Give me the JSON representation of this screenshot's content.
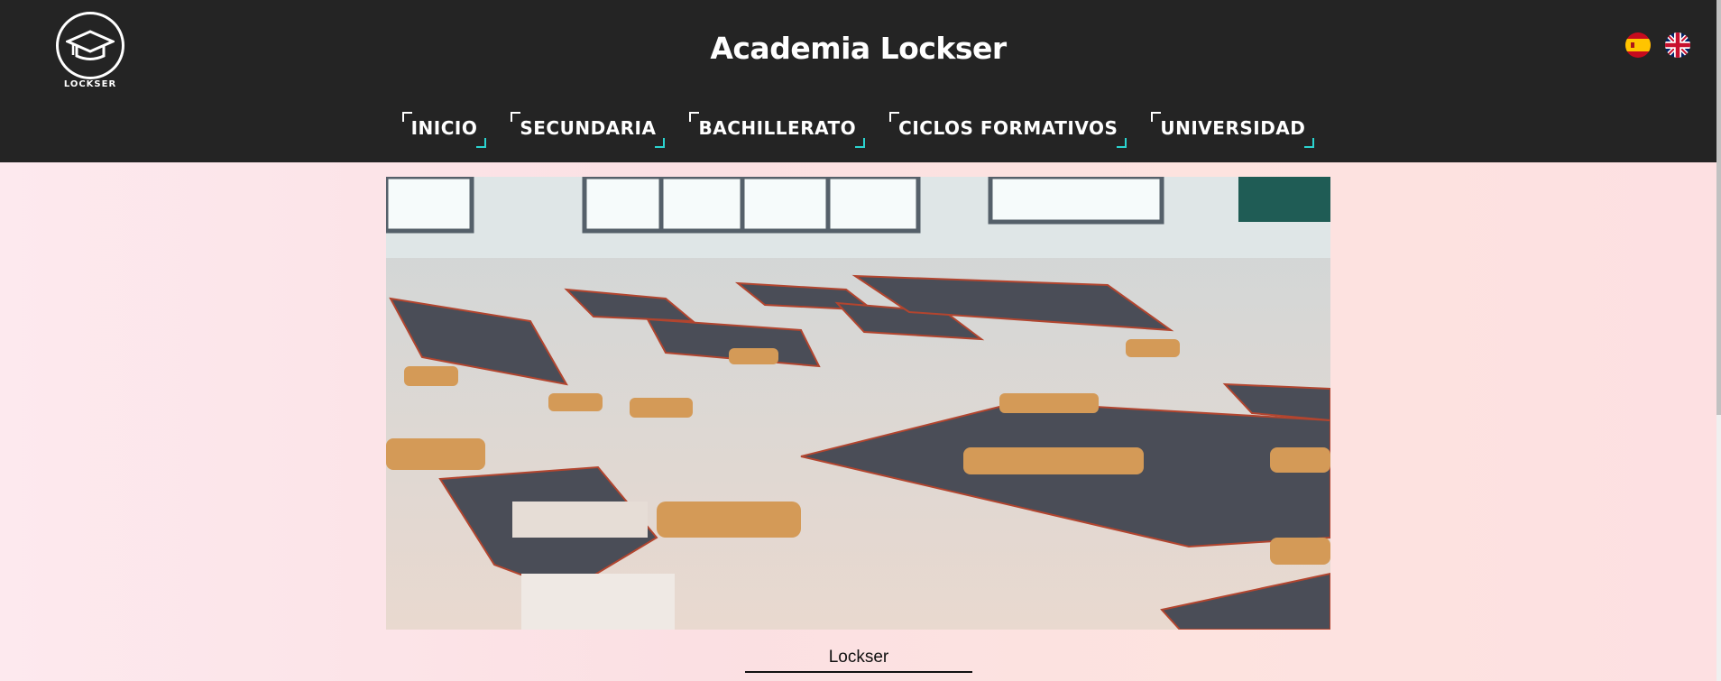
{
  "brand": {
    "logo_text": "LOCKSER",
    "title": "Academia Lockser"
  },
  "languages": [
    {
      "name": "español",
      "icon": "spain-flag-icon"
    },
    {
      "name": "english",
      "icon": "uk-flag-icon"
    }
  ],
  "nav": {
    "items": [
      {
        "label": "INICIO"
      },
      {
        "label": "SECUNDARIA"
      },
      {
        "label": "BACHILLERATO"
      },
      {
        "label": "CICLOS FORMATIVOS"
      },
      {
        "label": "UNIVERSIDAD"
      }
    ]
  },
  "hero": {
    "caption": "Lockser"
  },
  "colors": {
    "header_bg": "#242424",
    "nav_accent": "#2bd4d0",
    "page_bg": "#fbe3e6"
  }
}
